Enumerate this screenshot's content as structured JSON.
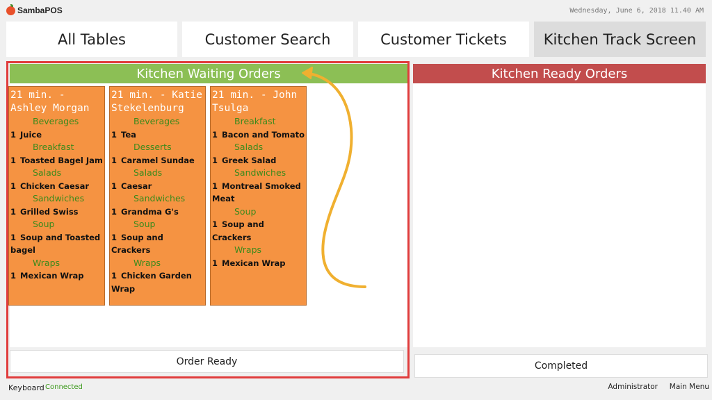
{
  "app": {
    "name": "SambaPOS",
    "datetime": "Wednesday, June 6, 2018 11.40 AM"
  },
  "tabs": [
    {
      "label": "All Tables",
      "active": false
    },
    {
      "label": "Customer Search",
      "active": false
    },
    {
      "label": "Customer Tickets",
      "active": false
    },
    {
      "label": "Kitchen Track Screen",
      "active": true
    }
  ],
  "waiting": {
    "header": "Kitchen Waiting Orders",
    "header_color": "#8cbf55",
    "orders": [
      {
        "title": "21 min. - Ashley Morgan",
        "lines": [
          {
            "type": "cat",
            "text": "Beverages"
          },
          {
            "type": "item",
            "qty": "1",
            "text": "Juice"
          },
          {
            "type": "cat",
            "text": "Breakfast"
          },
          {
            "type": "item",
            "qty": "1",
            "text": "Toasted Bagel Jam"
          },
          {
            "type": "cat",
            "text": "Salads"
          },
          {
            "type": "item",
            "qty": "1",
            "text": "Chicken Caesar"
          },
          {
            "type": "cat",
            "text": "Sandwiches"
          },
          {
            "type": "item",
            "qty": "1",
            "text": "Grilled Swiss"
          },
          {
            "type": "cat",
            "text": "Soup"
          },
          {
            "type": "item",
            "qty": "1",
            "text": "Soup and Toasted bagel"
          },
          {
            "type": "cat",
            "text": "Wraps"
          },
          {
            "type": "item",
            "qty": "1",
            "text": "Mexican Wrap"
          }
        ]
      },
      {
        "title": "21 min. - Katie Stekelenburg",
        "lines": [
          {
            "type": "cat",
            "text": "Beverages"
          },
          {
            "type": "item",
            "qty": "1",
            "text": "Tea"
          },
          {
            "type": "cat",
            "text": "Desserts"
          },
          {
            "type": "item",
            "qty": "1",
            "text": "Caramel Sundae"
          },
          {
            "type": "cat",
            "text": "Salads"
          },
          {
            "type": "item",
            "qty": "1",
            "text": "Caesar"
          },
          {
            "type": "cat",
            "text": "Sandwiches"
          },
          {
            "type": "item",
            "qty": "1",
            "text": "Grandma G's"
          },
          {
            "type": "cat",
            "text": "Soup"
          },
          {
            "type": "item",
            "qty": "1",
            "text": "Soup and Crackers"
          },
          {
            "type": "cat",
            "text": "Wraps"
          },
          {
            "type": "item",
            "qty": "1",
            "text": "Chicken Garden Wrap"
          }
        ]
      },
      {
        "title": "21 min. - John Tsulga",
        "lines": [
          {
            "type": "cat",
            "text": "Breakfast"
          },
          {
            "type": "item",
            "qty": "1",
            "text": "Bacon and Tomato"
          },
          {
            "type": "cat",
            "text": "Salads"
          },
          {
            "type": "item",
            "qty": "1",
            "text": "Greek Salad"
          },
          {
            "type": "cat",
            "text": "Sandwiches"
          },
          {
            "type": "item",
            "qty": "1",
            "text": "Montreal Smoked Meat"
          },
          {
            "type": "cat",
            "text": "Soup"
          },
          {
            "type": "item",
            "qty": "1",
            "text": "Soup and Crackers"
          },
          {
            "type": "cat",
            "text": "Wraps"
          },
          {
            "type": "item",
            "qty": "1",
            "text": "Mexican Wrap"
          }
        ]
      }
    ],
    "button": "Order Ready"
  },
  "ready": {
    "header": "Kitchen Ready Orders",
    "header_color": "#c24d4d",
    "button": "Completed"
  },
  "statusbar": {
    "keyboard_label": "Keyboard",
    "keyboard_status": "Connected",
    "user": "Administrator",
    "main_menu": "Main Menu"
  },
  "colors": {
    "card": "#f59342",
    "category_text": "#3c8a1c",
    "highlight": "#e03c3c",
    "arrow": "#f0b030"
  }
}
